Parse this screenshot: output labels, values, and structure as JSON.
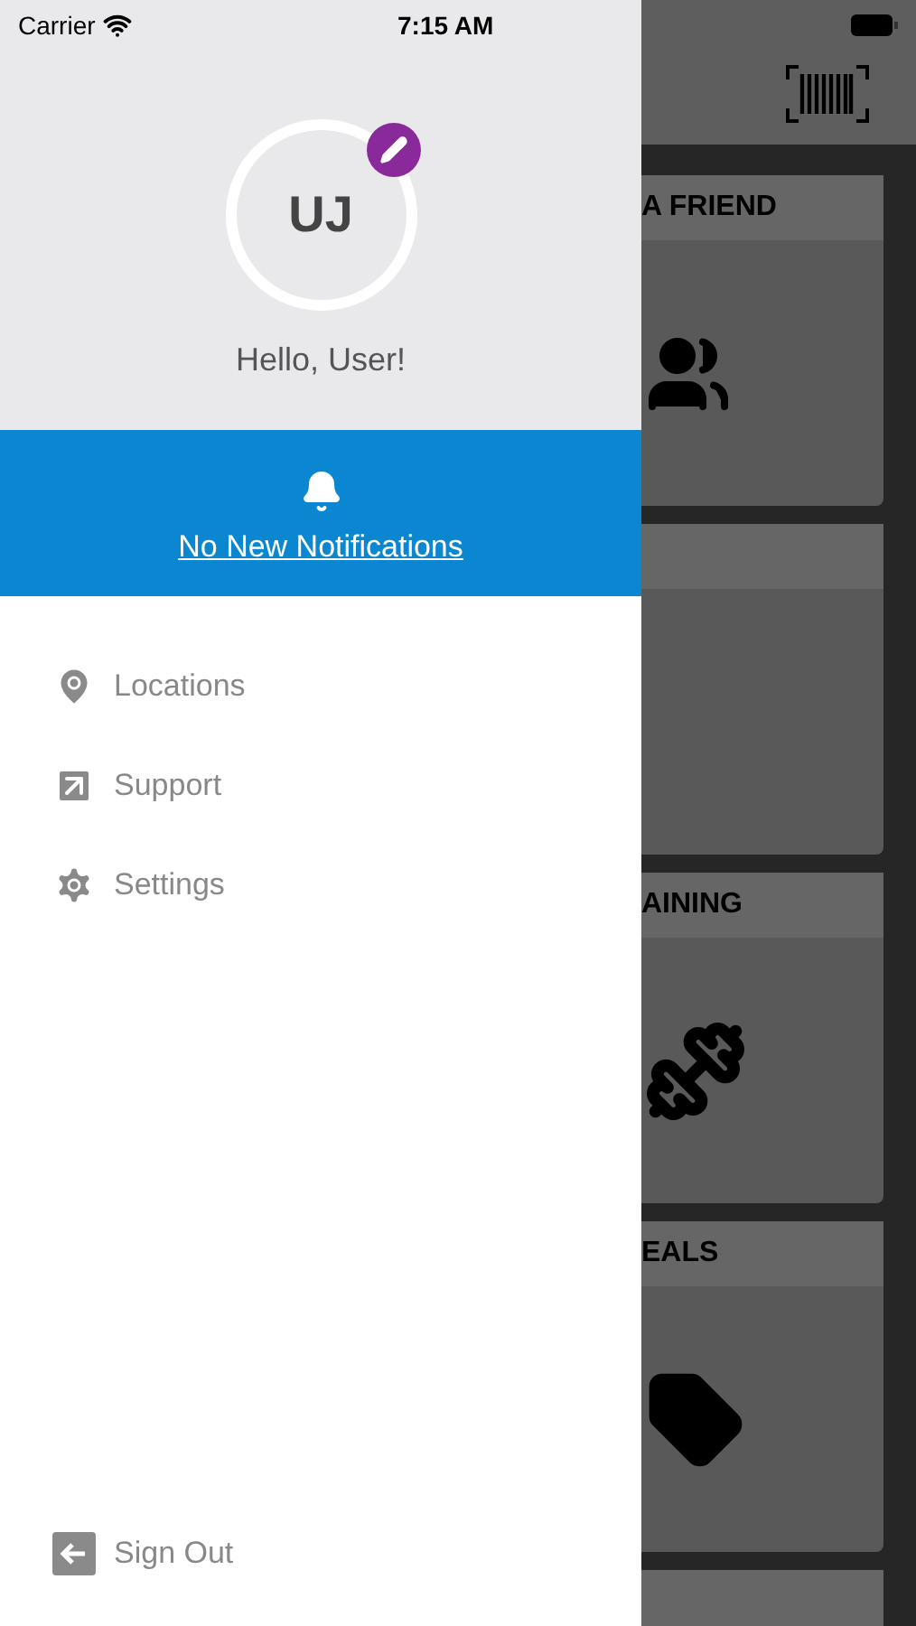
{
  "status_bar": {
    "carrier": "Carrier",
    "time": "7:15 AM"
  },
  "profile": {
    "initials": "UJ",
    "greeting": "Hello, User!"
  },
  "notifications": {
    "text": "No New Notifications"
  },
  "menu": [
    {
      "label": "Locations",
      "kind": "location"
    },
    {
      "label": "Support",
      "kind": "support"
    },
    {
      "label": "Settings",
      "kind": "settings"
    }
  ],
  "sign_out": {
    "label": "Sign Out"
  },
  "background_cards": [
    {
      "title": "A FRIEND",
      "kind": "friend"
    },
    {
      "kind": "blank"
    },
    {
      "title": "AINING",
      "kind": "training"
    },
    {
      "title": "EALS",
      "kind": "deals"
    },
    {
      "kind": "blank"
    }
  ]
}
